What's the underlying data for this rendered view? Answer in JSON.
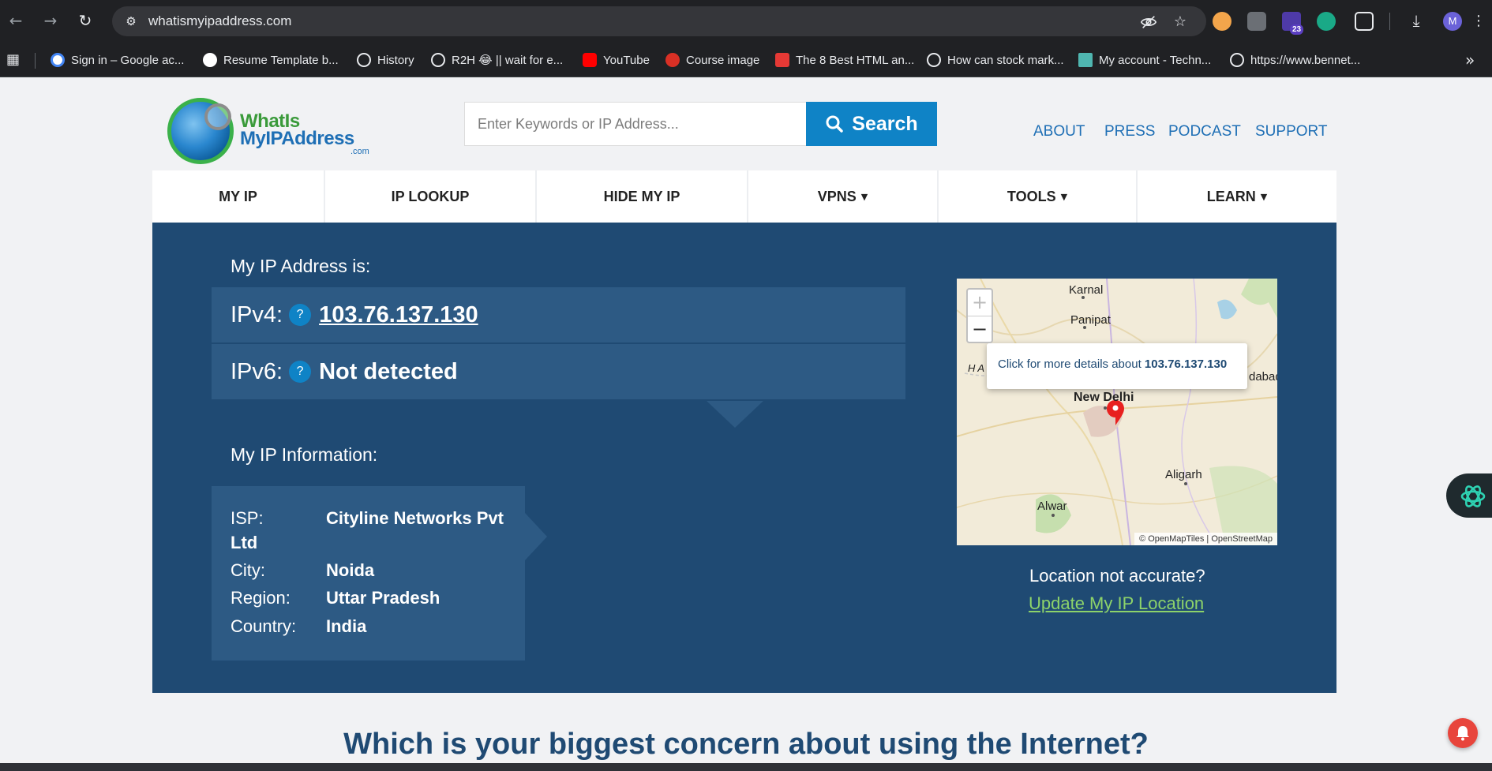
{
  "browser": {
    "url": "whatismyipaddress.com",
    "extension_badge": "23",
    "profile_initial": "M",
    "bookmarks": [
      {
        "label": "Sign in – Google ac...",
        "color": "#ffffff"
      },
      {
        "label": "Resume Template b...",
        "color": "#ffffff"
      },
      {
        "label": "History",
        "color": "#e8eaed"
      },
      {
        "label": "R2H 😂 || wait for e...",
        "color": "#e8eaed"
      },
      {
        "label": "YouTube",
        "color": "#ff0000"
      },
      {
        "label": "Course image",
        "color": "#d93025"
      },
      {
        "label": "The 8 Best HTML an...",
        "color": "#e53935"
      },
      {
        "label": "How can stock mark...",
        "color": "#e8eaed"
      },
      {
        "label": "My account - Techn...",
        "color": "#4fb6b0"
      },
      {
        "label": "https://www.bennet...",
        "color": "#e8eaed"
      }
    ]
  },
  "site": {
    "logo": {
      "line1": "WhatIs",
      "line2": "MyIPAddress",
      "line3": ".com"
    },
    "search": {
      "placeholder": "Enter Keywords or IP Address...",
      "button": "Search"
    },
    "top_nav": [
      "ABOUT",
      "PRESS",
      "PODCAST",
      "SUPPORT"
    ],
    "menu": [
      {
        "label": "MY IP",
        "dropdown": false
      },
      {
        "label": "IP LOOKUP",
        "dropdown": false
      },
      {
        "label": "HIDE MY IP",
        "dropdown": false
      },
      {
        "label": "VPNS",
        "dropdown": true
      },
      {
        "label": "TOOLS",
        "dropdown": true
      },
      {
        "label": "LEARN",
        "dropdown": true
      }
    ],
    "caret": "▼"
  },
  "ip": {
    "heading": "My IP Address is:",
    "ipv4_label": "IPv4:",
    "ipv4_value": "103.76.137.130",
    "ipv6_label": "IPv6:",
    "ipv6_value": "Not detected",
    "help": "?"
  },
  "info": {
    "heading": "My IP Information:",
    "rows": [
      {
        "key": "ISP:",
        "value": "Cityline Networks Pvt",
        "value2": "Ltd"
      },
      {
        "key": "City:",
        "value": "Noida"
      },
      {
        "key": "Region:",
        "value": "Uttar Pradesh"
      },
      {
        "key": "Country:",
        "value": "India"
      }
    ]
  },
  "map": {
    "popup_prefix": "Click for more details about",
    "popup_ip": "103.76.137.130",
    "labels": [
      "Karnal",
      "Panipat",
      "HA",
      "New Delhi",
      "dabad",
      "Aligarh",
      "Alwar"
    ],
    "attribution": "© OpenMapTiles | OpenStreetMap",
    "zoom_in": "+",
    "zoom_out": "−"
  },
  "location": {
    "question": "Location not accurate?",
    "link": "Update My IP Location"
  },
  "concern": "Which is your biggest concern about using the Internet?",
  "colors": {
    "hero": "#1f4a73",
    "panel": "#2d5a84",
    "accent": "#0f83c6",
    "link_green": "#8dd36a"
  }
}
